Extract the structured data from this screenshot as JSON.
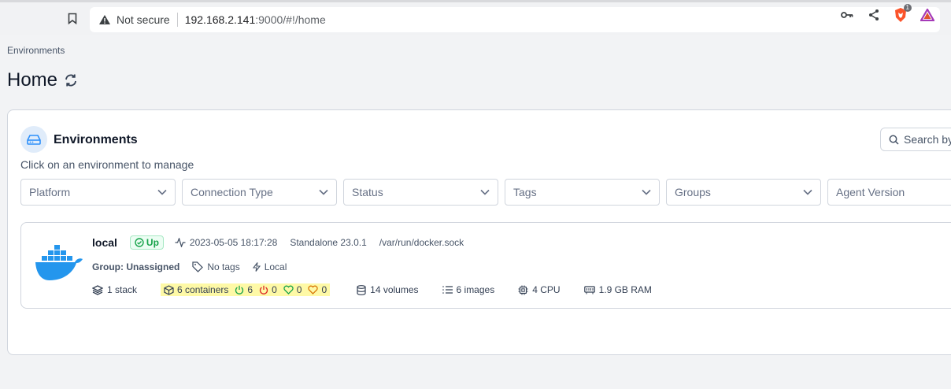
{
  "browser": {
    "security_text": "Not secure",
    "url_host": "192.168.2.141",
    "url_path": ":9000/#!/home",
    "brave_badge": "1"
  },
  "page": {
    "breadcrumb": "Environments",
    "title": "Home"
  },
  "environments_panel": {
    "title": "Environments",
    "subtitle": "Click on an environment to manage",
    "search_placeholder": "Search by",
    "filters": [
      "Platform",
      "Connection Type",
      "Status",
      "Tags",
      "Groups",
      "Agent Version"
    ]
  },
  "environment": {
    "name": "local",
    "status": "Up",
    "timestamp": "2023-05-05 18:17:28",
    "type": "Standalone 23.0.1",
    "socket": "/var/run/docker.sock",
    "group": "Group: Unassigned",
    "tags": "No tags",
    "locality": "Local",
    "stacks": "1 stack",
    "containers": "6 containers",
    "running": "6",
    "stopped": "0",
    "healthy": "0",
    "unhealthy": "0",
    "volumes": "14 volumes",
    "images": "6 images",
    "cpu": "4 CPU",
    "ram": "1.9 GB RAM"
  },
  "colors": {
    "accent_blue": "#2496ed",
    "up_green": "#16a34a",
    "stopped_red": "#dc2626",
    "unhealthy_orange": "#d97706",
    "highlight_yellow": "#fef9a6"
  }
}
